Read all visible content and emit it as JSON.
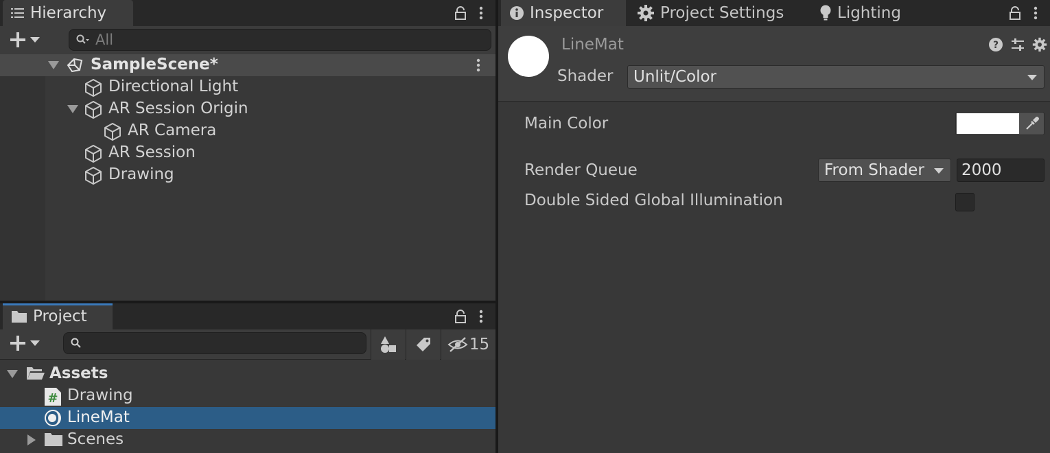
{
  "hierarchy": {
    "tab_label": "Hierarchy",
    "search_placeholder": "All",
    "scene_name": "SampleScene*",
    "items": [
      {
        "label": "Directional Light"
      },
      {
        "label": "AR Session Origin"
      },
      {
        "label": "AR Camera"
      },
      {
        "label": "AR Session"
      },
      {
        "label": "Drawing"
      }
    ]
  },
  "project": {
    "tab_label": "Project",
    "search_placeholder": "",
    "hidden_count": "15",
    "root": "Assets",
    "items": [
      {
        "label": "Drawing",
        "icon": "csharp-script-icon"
      },
      {
        "label": "LineMat",
        "icon": "material-icon",
        "selected": true
      },
      {
        "label": "Scenes",
        "icon": "folder-icon"
      }
    ]
  },
  "inspector": {
    "tabs": [
      {
        "label": "Inspector",
        "icon": "info-icon"
      },
      {
        "label": "Project Settings",
        "icon": "gear-icon"
      },
      {
        "label": "Lighting",
        "icon": "lightbulb-icon"
      }
    ],
    "asset_name": "LineMat",
    "shader_label": "Shader",
    "shader_value": "Unlit/Color",
    "properties": {
      "main_color_label": "Main Color",
      "main_color_value": "#ffffff",
      "render_queue_label": "Render Queue",
      "render_queue_mode": "From Shader",
      "render_queue_value": "2000",
      "double_sided_gi_label": "Double Sided Global Illumination",
      "double_sided_gi_checked": false
    }
  },
  "colors": {
    "selection": "#2c5d87",
    "accent": "#3a79bb",
    "panel_bg": "#383838"
  }
}
